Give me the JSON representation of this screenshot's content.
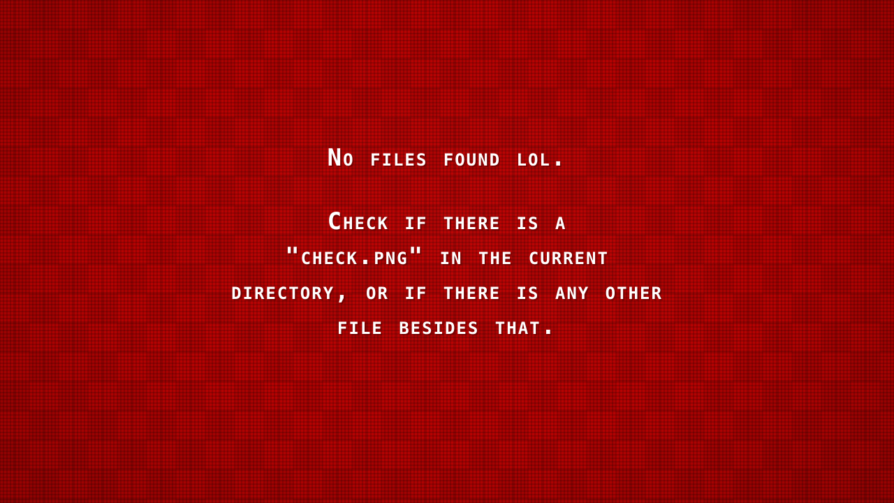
{
  "screen": {
    "background_color": "#b00000",
    "text_color": "#ffffff",
    "headline": "No files found lol.",
    "body_lines": [
      "Check if there is a",
      "\"check.png\" in the current",
      "directory, or if there is any other",
      "file besides that."
    ]
  }
}
